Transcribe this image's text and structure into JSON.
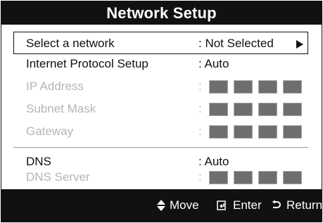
{
  "window": {
    "title": "Network Setup"
  },
  "rows": [
    {
      "label": "Select a network",
      "value": ": Not Selected",
      "disabled": false,
      "selected": true
    },
    {
      "label": "Internet Protocol Setup",
      "value": ": Auto",
      "disabled": false
    },
    {
      "label": "IP Address",
      "value": ":",
      "disabled": true
    },
    {
      "label": "Subnet Mask",
      "value": ":",
      "disabled": true
    },
    {
      "label": "Gateway",
      "value": ":",
      "disabled": true
    },
    {
      "label": "DNS",
      "value": ": Auto",
      "disabled": false
    },
    {
      "label": "DNS Server",
      "value": ":",
      "disabled": true
    }
  ],
  "footer": {
    "move": "Move",
    "enter": "Enter",
    "return": "Return"
  },
  "colors": {
    "title_bg": "#111111",
    "footer_bg": "#111111",
    "disabled_text": "#b5b5b5",
    "ip_block": "#6e6e6e"
  },
  "icons": {
    "move": "updown-icon",
    "enter": "enter-icon",
    "return": "return-icon"
  }
}
